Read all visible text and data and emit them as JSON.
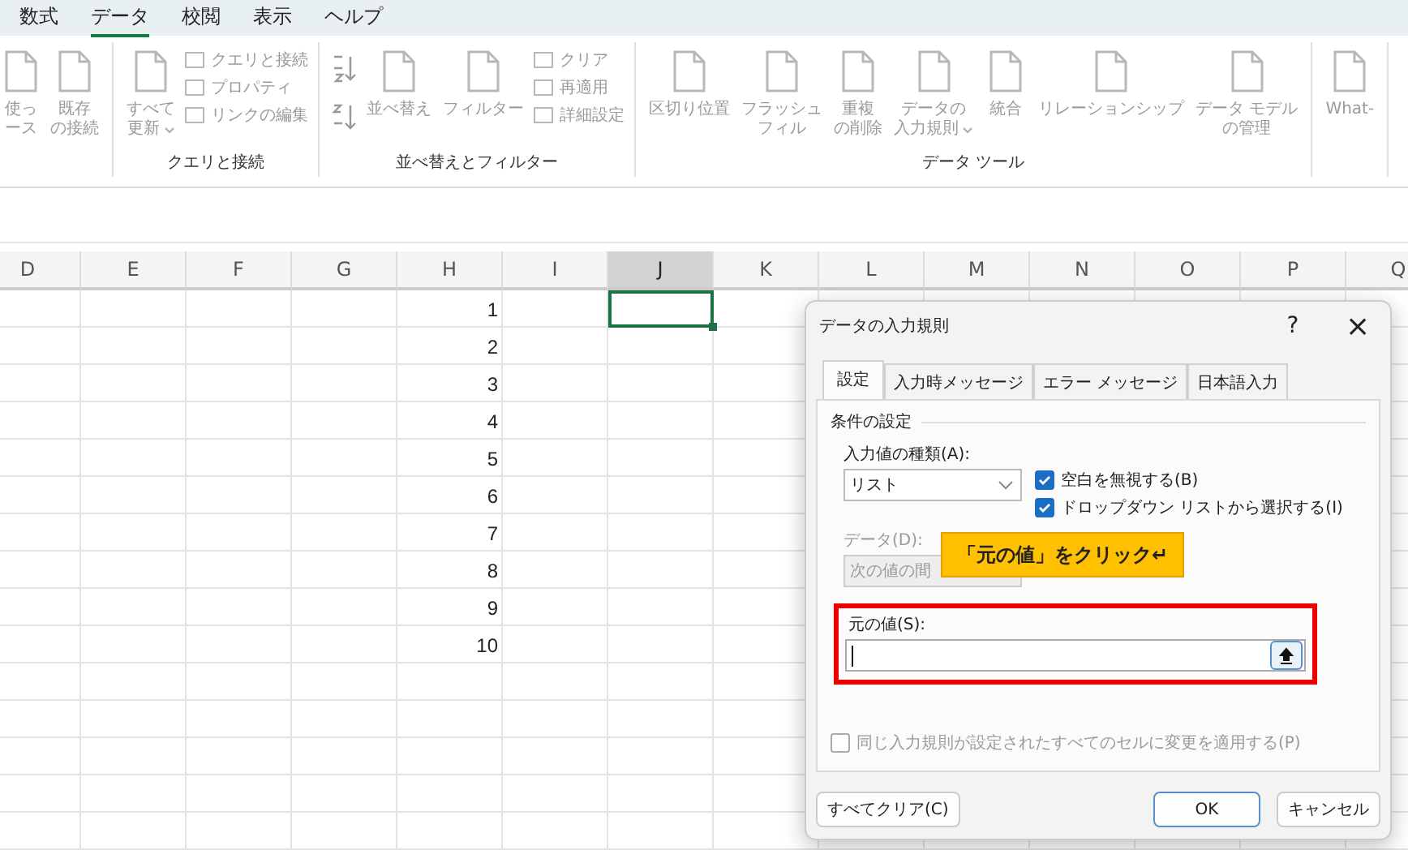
{
  "menu_tabs": [
    {
      "label": "数式",
      "selected": false
    },
    {
      "label": "データ",
      "selected": true
    },
    {
      "label": "校閲",
      "selected": false
    },
    {
      "label": "表示",
      "selected": false
    },
    {
      "label": "ヘルプ",
      "selected": false
    }
  ],
  "ribbon": {
    "groups": [
      {
        "items": [
          {
            "kind": "large",
            "lines": [
              "使っ",
              "ース"
            ]
          },
          {
            "kind": "large",
            "lines": [
              "既存",
              "の接続"
            ]
          }
        ]
      },
      {
        "label": "クエリと接続",
        "items": [
          {
            "kind": "large",
            "lines": [
              "すべて",
              "更新"
            ],
            "dropdown": true
          },
          {
            "kind": "stack",
            "entries": [
              "クエリと接続",
              "プロパティ",
              "リンクの編集"
            ]
          }
        ]
      },
      {
        "label": "並べ替えとフィルター",
        "items": [
          {
            "kind": "sortpair"
          },
          {
            "kind": "large",
            "lines": [
              "並べ替え"
            ]
          },
          {
            "kind": "large",
            "lines": [
              "フィルター"
            ]
          },
          {
            "kind": "stack",
            "entries": [
              "クリア",
              "再適用",
              "詳細設定"
            ]
          }
        ]
      },
      {
        "label": "データ ツール",
        "items": [
          {
            "kind": "large",
            "lines": [
              "区切り位置"
            ]
          },
          {
            "kind": "large",
            "lines": [
              "フラッシュ",
              "フィル"
            ]
          },
          {
            "kind": "large",
            "lines": [
              "重複",
              "の削除"
            ]
          },
          {
            "kind": "large",
            "lines": [
              "データの",
              "入力規則"
            ],
            "dropdown": true
          },
          {
            "kind": "large",
            "lines": [
              "統合"
            ]
          },
          {
            "kind": "large",
            "lines": [
              "リレーションシップ"
            ]
          },
          {
            "kind": "large",
            "lines": [
              "データ モデル",
              "の管理"
            ]
          }
        ]
      },
      {
        "items": [
          {
            "kind": "large",
            "lines": [
              "What-"
            ]
          }
        ]
      }
    ]
  },
  "sheet": {
    "columns": [
      {
        "label": "D",
        "selected": false
      },
      {
        "label": "E",
        "selected": false
      },
      {
        "label": "F",
        "selected": false
      },
      {
        "label": "G",
        "selected": false
      },
      {
        "label": "H",
        "selected": false,
        "cells": [
          "1",
          "2",
          "3",
          "4",
          "5",
          "6",
          "7",
          "8",
          "9",
          "10"
        ]
      },
      {
        "label": "I",
        "selected": false
      },
      {
        "label": "J",
        "selected": true
      },
      {
        "label": "K",
        "selected": false
      },
      {
        "label": "L",
        "selected": false
      },
      {
        "label": "M",
        "selected": false
      },
      {
        "label": "N",
        "selected": false
      },
      {
        "label": "O",
        "selected": false
      },
      {
        "label": "P",
        "selected": false
      },
      {
        "label": "Q",
        "selected": false
      }
    ]
  },
  "dialog": {
    "title": "データの入力規則",
    "help": "?",
    "close": "×",
    "tabs": [
      {
        "label": "設定",
        "selected": true
      },
      {
        "label": "入力時メッセージ",
        "selected": false
      },
      {
        "label": "エラー メッセージ",
        "selected": false
      },
      {
        "label": "日本語入力",
        "selected": false
      }
    ],
    "section": "条件の設定",
    "allow_label": "入力値の種類(A):",
    "allow_value": "リスト",
    "ignore_blank": {
      "label": "空白を無視する(B)",
      "checked": true
    },
    "in_cell_dropdown": {
      "label": "ドロップダウン リストから選択する(I)",
      "checked": true
    },
    "data_label": "データ(D):",
    "data_value": "次の値の間",
    "source_label": "元の値(S):",
    "apply_all": {
      "label": "同じ入力規則が設定されたすべてのセルに変更を適用する(P)",
      "checked": false
    },
    "buttons": {
      "clear": "すべてクリア(C)",
      "ok": "OK",
      "cancel": "キャンセル"
    }
  },
  "callout": "「元の値」をクリック↵"
}
